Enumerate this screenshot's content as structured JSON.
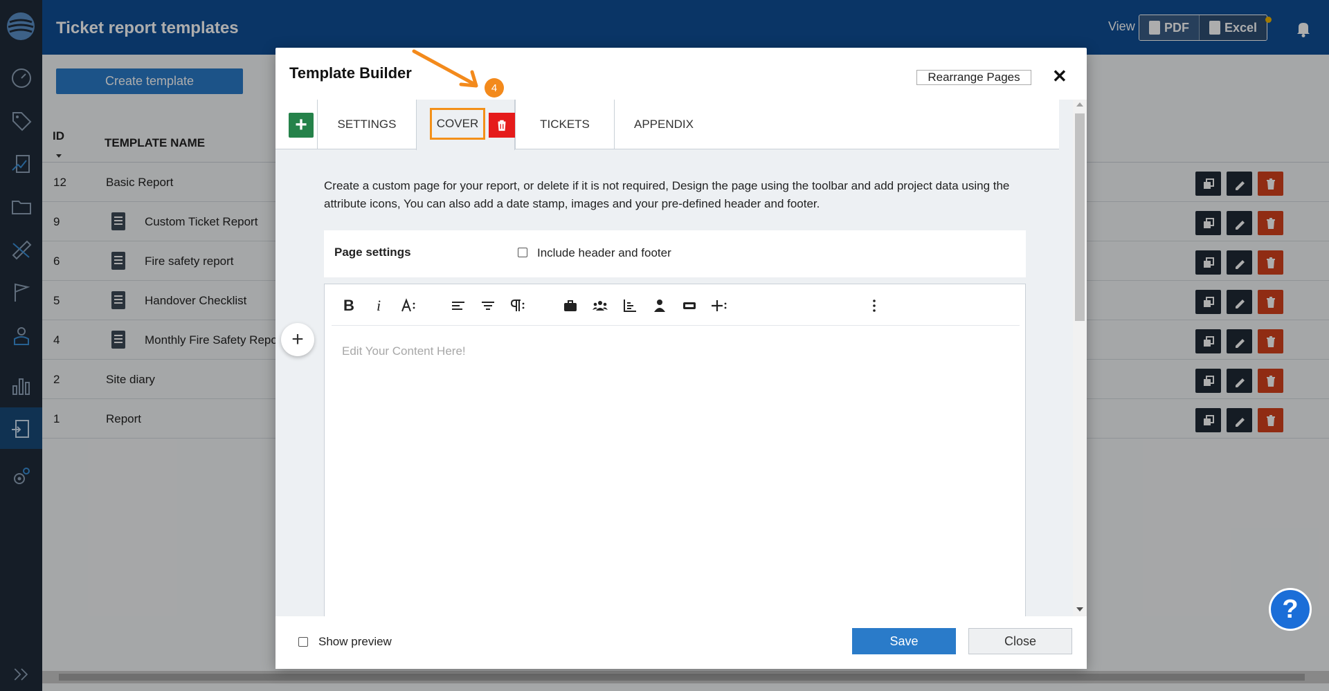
{
  "header": {
    "title": "Ticket report templates",
    "view_label": "View",
    "pdf_label": "PDF",
    "excel_label": "Excel"
  },
  "toolbar": {
    "create_label": "Create template"
  },
  "table": {
    "col_id": "ID",
    "col_name": "TEMPLATE NAME",
    "rows": [
      {
        "id": "12",
        "name": "Basic Report",
        "has_icon": false
      },
      {
        "id": "9",
        "name": "Custom Ticket Report",
        "has_icon": true
      },
      {
        "id": "6",
        "name": "Fire safety report",
        "has_icon": true
      },
      {
        "id": "5",
        "name": "Handover Checklist",
        "has_icon": true
      },
      {
        "id": "4",
        "name": "Monthly Fire Safety Repo",
        "has_icon": true
      },
      {
        "id": "2",
        "name": "Site diary",
        "has_icon": false
      },
      {
        "id": "1",
        "name": "Report",
        "has_icon": false
      }
    ]
  },
  "modal": {
    "title": "Template Builder",
    "rearrange_label": "Rearrange Pages",
    "close_symbol": "✕",
    "tabs": {
      "settings": "SETTINGS",
      "cover": "COVER",
      "tickets": "TICKETS",
      "appendix": "APPENDIX"
    },
    "step_number": "4",
    "description": "Create a custom page for your report, or delete if it is not required, Design the page using the toolbar and add project data using the attribute icons, You can also add a date stamp, images and your pre-defined header and footer.",
    "page_settings_label": "Page settings",
    "include_header_footer_label": "Include header and footer",
    "editor_placeholder": "Edit Your Content Here!",
    "show_preview_label": "Show preview",
    "save_label": "Save",
    "close_label": "Close"
  },
  "help_symbol": "?",
  "colors": {
    "sidebar": "#1f2c3a",
    "header": "#0f4e97",
    "primary_button": "#2a7bc9",
    "add_button": "#25824a",
    "delete_red": "#e51b1b",
    "highlight_orange": "#f39019"
  }
}
